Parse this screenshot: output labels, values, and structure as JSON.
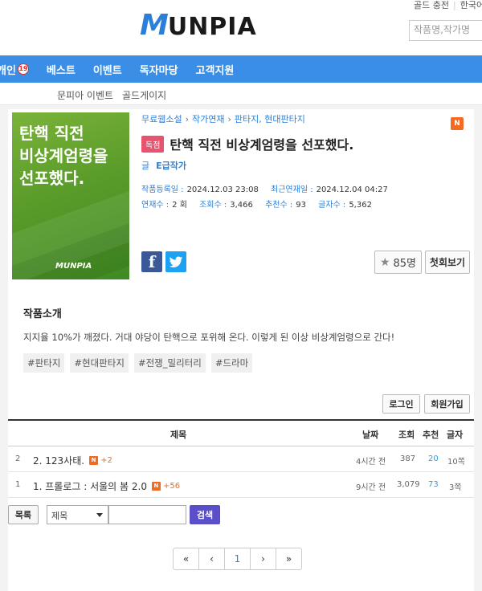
{
  "header": {
    "logo_text": "UNPIA",
    "logo_m": "M",
    "top_links": [
      "골드 충전",
      "한국어"
    ],
    "search_placeholder": "작품명,작가명"
  },
  "nav": {
    "items": [
      "개인",
      "베스트",
      "이벤트",
      "독자마당",
      "고객지원"
    ],
    "age_badge": "19"
  },
  "subnav": {
    "items": [
      "문피아 이벤트",
      "골드게이지"
    ]
  },
  "novel": {
    "cover_title": "탄핵 직전\n비상계엄령을\n선포했다.",
    "cover_logo": "MUNPIA",
    "breadcrumb": [
      "무료웹소설",
      "작가연재",
      "판타지, 현대판타지"
    ],
    "n_badge": "N",
    "exclusive_badge": "독점",
    "title": "탄핵 직전 비상계엄령을 선포했다.",
    "author_label": "글",
    "author_name": "E급작가",
    "registered_label": "작품등록일 :",
    "registered_value": "2024.12.03 23:08",
    "latest_label": "최근연재일 :",
    "latest_value": "2024.12.04 04:27",
    "episodes_label": "연재수 :",
    "episodes_value": "2 회",
    "views_label": "조회수 :",
    "views_value": "3,466",
    "recommend_label": "추천수 :",
    "recommend_value": "93",
    "chars_label": "글자수 :",
    "chars_value": "5,362",
    "facebook_glyph": "f",
    "twitter_glyph": "t",
    "recommend_count": "85명",
    "first_view_label": "첫회보기"
  },
  "intro": {
    "heading": "작품소개",
    "text": "지지율 10%가 깨졌다. 거대 야당이 탄핵으로 포위해 온다. 이렇게 된 이상 비상계엄령으로 간다!",
    "tags": [
      "#판타지",
      "#현대판타지",
      "#전쟁_밀리터리",
      "#드라마"
    ]
  },
  "auth": {
    "login_label": "로그인",
    "signup_label": "회원가입"
  },
  "table": {
    "headers": {
      "title": "제목",
      "date": "날짜",
      "views": "조회",
      "rec": "추천",
      "chars": "글자"
    },
    "rows": [
      {
        "no": "2",
        "title": "2. 123사태.",
        "n": "N",
        "plus": "+2",
        "date": "4시간 전",
        "views": "387",
        "rec": "20",
        "chars": "10쪽"
      },
      {
        "no": "1",
        "title": "1. 프롤로그 : 서울의 봄 2.0",
        "n": "N",
        "plus": "+56",
        "date": "9시간 전",
        "views": "3,079",
        "rec": "73",
        "chars": "3쪽"
      }
    ]
  },
  "controls": {
    "list_label": "목록",
    "select_value": "제목",
    "search_label": "검색"
  },
  "pager": {
    "first": "«",
    "prev": "‹",
    "current": "1",
    "next": "›",
    "last": "»"
  }
}
